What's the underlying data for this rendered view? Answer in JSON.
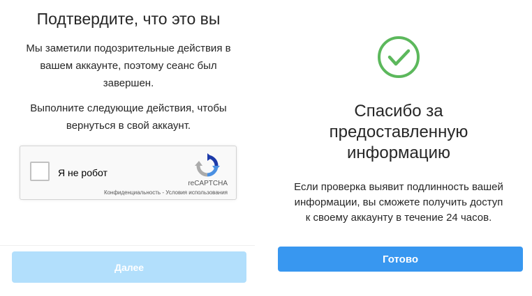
{
  "left": {
    "title": "Подтвердите, что это вы",
    "description_lines": [
      "Мы заметили подозрительные действия в",
      "вашем аккаунте, поэтому сеанс был",
      "завершен."
    ],
    "instruction_lines": [
      "Выполните следующие действия, чтобы",
      "вернуться в свой аккаунт."
    ],
    "captcha": {
      "checkbox_label": "Я не робот",
      "checked": false,
      "brand": "reCAPTCHA",
      "privacy_link": "Конфиденциальность",
      "separator": " - ",
      "terms_link": "Условия использования",
      "icon": "recaptcha-logo"
    },
    "next_button": {
      "label": "Далее",
      "enabled": false
    }
  },
  "right": {
    "status_icon": "check-circle",
    "status_color": "#5cb85c",
    "title_lines": [
      "Спасибо за",
      "предоставленную",
      "информацию"
    ],
    "message_lines": [
      "Если проверка выявит подлинность вашей",
      "информации, вы сможете получить доступ",
      "к своему аккаунту в течение 24 часов."
    ],
    "done_button": {
      "label": "Готово"
    }
  },
  "colors": {
    "primary": "#3897f0",
    "primary_disabled": "#b2dffc",
    "text": "#262626"
  }
}
